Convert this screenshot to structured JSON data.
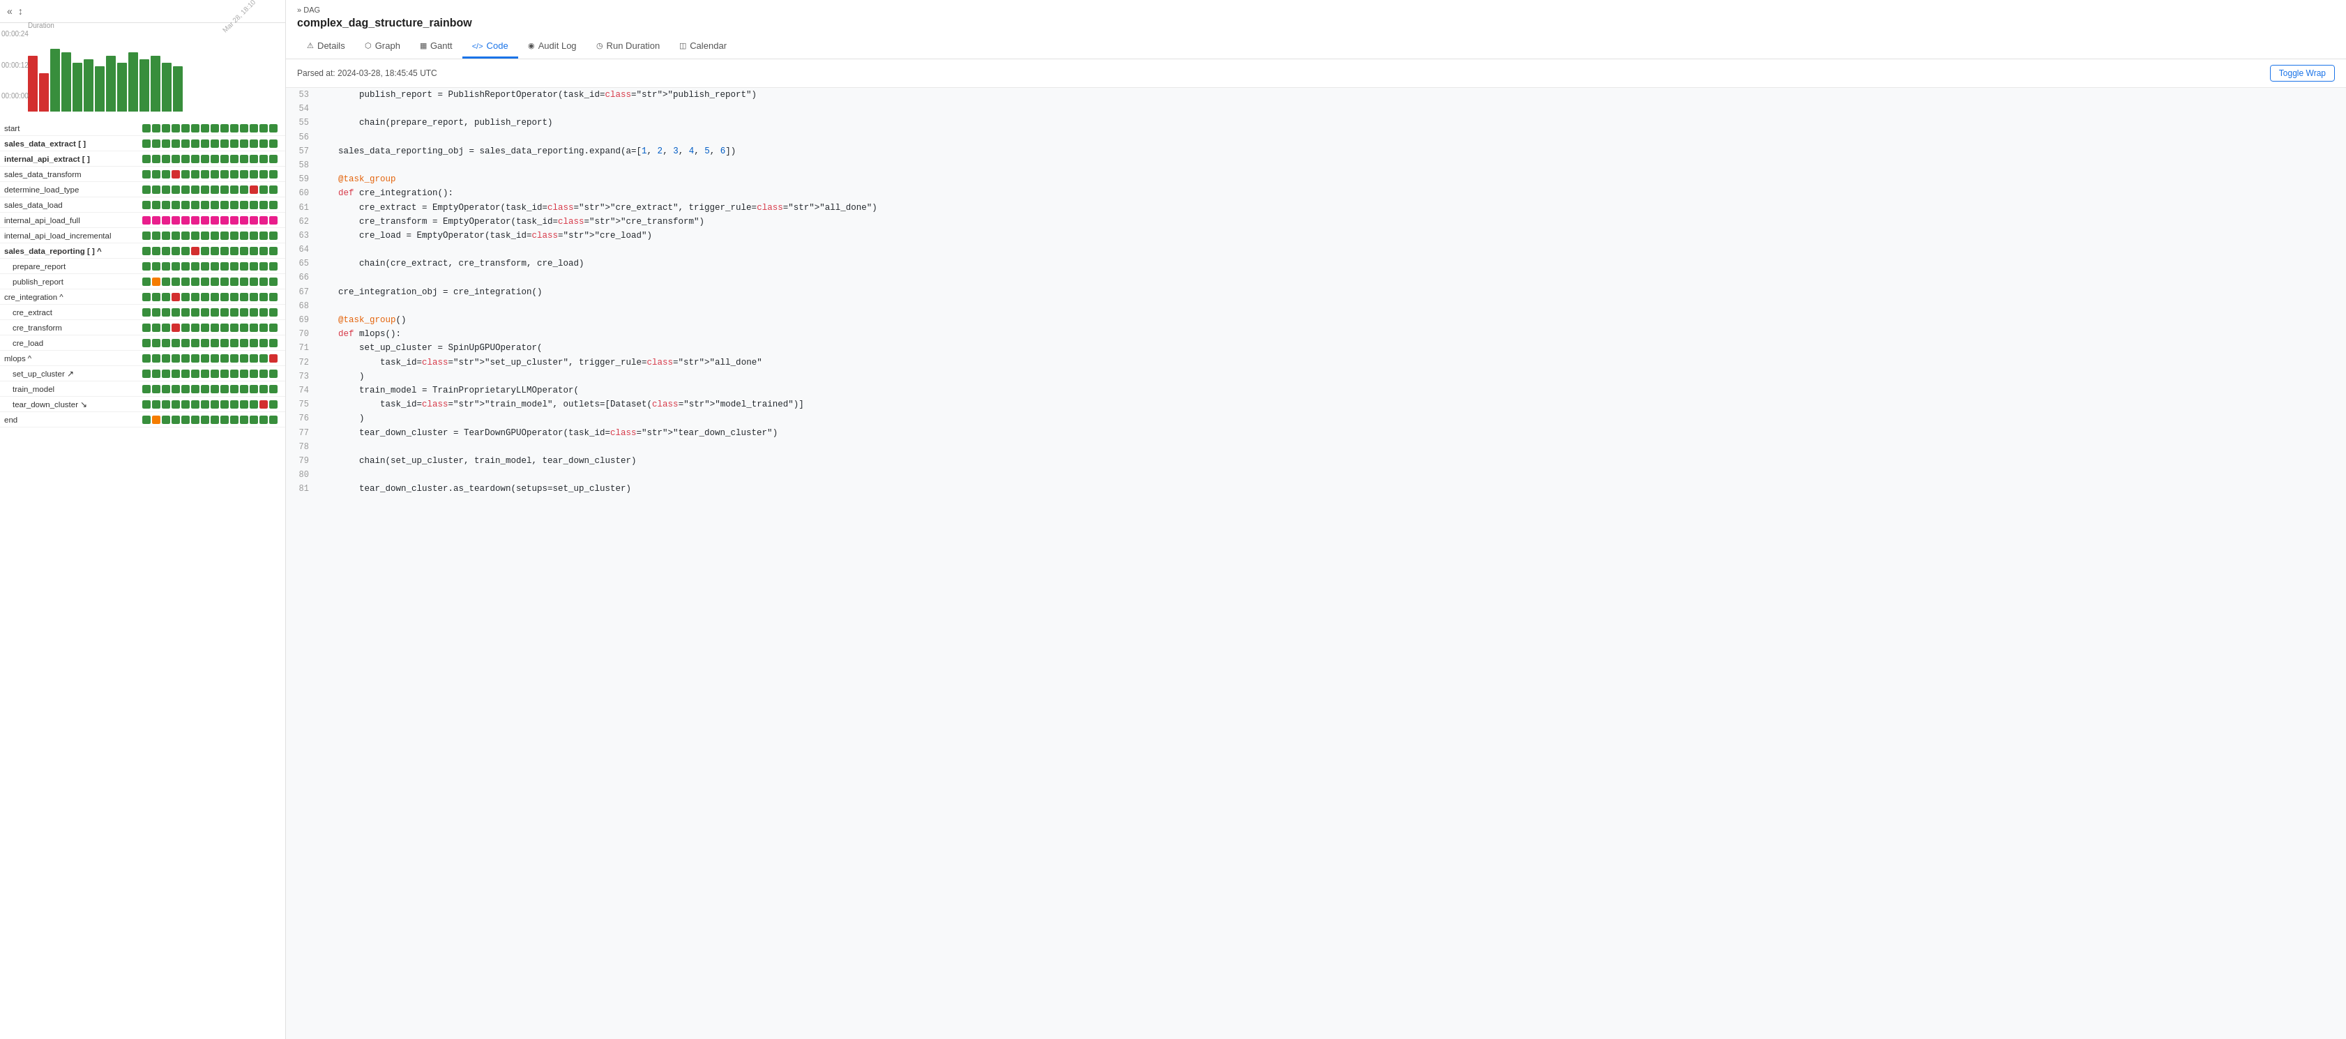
{
  "left": {
    "collapse_icon": "«",
    "duration_label": "Duration",
    "y_labels": [
      "00:00:24",
      "00:00:12",
      "00:00:00"
    ],
    "date_label": "Mar 28, 18:10",
    "bars": [
      {
        "height": 80,
        "color": "#d32f2f"
      },
      {
        "height": 55,
        "color": "#d32f2f"
      },
      {
        "height": 90,
        "color": "#388e3c"
      },
      {
        "height": 85,
        "color": "#388e3c"
      },
      {
        "height": 70,
        "color": "#388e3c"
      },
      {
        "height": 75,
        "color": "#388e3c"
      },
      {
        "height": 65,
        "color": "#388e3c"
      },
      {
        "height": 80,
        "color": "#388e3c"
      },
      {
        "height": 70,
        "color": "#388e3c"
      },
      {
        "height": 85,
        "color": "#388e3c"
      },
      {
        "height": 75,
        "color": "#388e3c"
      },
      {
        "height": 80,
        "color": "#388e3c"
      },
      {
        "height": 70,
        "color": "#388e3c"
      },
      {
        "height": 65,
        "color": "#388e3c"
      }
    ],
    "tasks": [
      {
        "label": "start",
        "bold": false,
        "indent": 0,
        "dots": [
          "g",
          "g",
          "g",
          "g",
          "g",
          "g",
          "g",
          "g",
          "g",
          "g",
          "g",
          "g",
          "g",
          "g"
        ]
      },
      {
        "label": "sales_data_extract [ ]",
        "bold": true,
        "indent": 0,
        "dots": [
          "g",
          "g",
          "g",
          "g",
          "g",
          "g",
          "g",
          "g",
          "g",
          "g",
          "g",
          "g",
          "g",
          "g"
        ]
      },
      {
        "label": "internal_api_extract [ ]",
        "bold": true,
        "indent": 0,
        "dots": [
          "g",
          "g",
          "g",
          "g",
          "g",
          "g",
          "g",
          "g",
          "g",
          "g",
          "g",
          "g",
          "g",
          "g"
        ]
      },
      {
        "label": "sales_data_transform",
        "bold": false,
        "indent": 0,
        "dots": [
          "g",
          "g",
          "g",
          "r",
          "g",
          "g",
          "g",
          "g",
          "g",
          "g",
          "g",
          "g",
          "g",
          "g"
        ]
      },
      {
        "label": "determine_load_type",
        "bold": false,
        "indent": 0,
        "dots": [
          "g",
          "g",
          "g",
          "g",
          "g",
          "g",
          "g",
          "g",
          "g",
          "g",
          "g",
          "r",
          "g",
          "g"
        ]
      },
      {
        "label": "sales_data_load",
        "bold": false,
        "indent": 0,
        "dots": [
          "g",
          "g",
          "g",
          "g",
          "g",
          "g",
          "g",
          "g",
          "g",
          "g",
          "g",
          "g",
          "g",
          "g"
        ]
      },
      {
        "label": "internal_api_load_full",
        "bold": false,
        "indent": 0,
        "dots": [
          "p",
          "p",
          "p",
          "p",
          "p",
          "p",
          "p",
          "p",
          "p",
          "p",
          "p",
          "p",
          "p",
          "p"
        ]
      },
      {
        "label": "internal_api_load_incremental",
        "bold": false,
        "indent": 0,
        "dots": [
          "g",
          "g",
          "g",
          "g",
          "g",
          "g",
          "g",
          "g",
          "g",
          "g",
          "g",
          "g",
          "g",
          "g"
        ]
      },
      {
        "label": "sales_data_reporting [ ] ^",
        "bold": true,
        "indent": 0,
        "dots": [
          "g",
          "g",
          "g",
          "g",
          "g",
          "r",
          "g",
          "g",
          "g",
          "g",
          "g",
          "g",
          "g",
          "g"
        ]
      },
      {
        "label": "prepare_report",
        "bold": false,
        "indent": 1,
        "dots": [
          "g",
          "g",
          "g",
          "g",
          "g",
          "g",
          "g",
          "g",
          "g",
          "g",
          "g",
          "g",
          "g",
          "g"
        ]
      },
      {
        "label": "publish_report",
        "bold": false,
        "indent": 1,
        "dots": [
          "g",
          "o",
          "g",
          "g",
          "g",
          "g",
          "g",
          "g",
          "g",
          "g",
          "g",
          "g",
          "g",
          "g"
        ]
      },
      {
        "label": "cre_integration ^",
        "bold": false,
        "indent": 0,
        "dots": [
          "g",
          "g",
          "g",
          "r",
          "g",
          "g",
          "g",
          "g",
          "g",
          "g",
          "g",
          "g",
          "g",
          "g"
        ]
      },
      {
        "label": "cre_extract",
        "bold": false,
        "indent": 1,
        "dots": [
          "g",
          "g",
          "g",
          "g",
          "g",
          "g",
          "g",
          "g",
          "g",
          "g",
          "g",
          "g",
          "g",
          "g"
        ]
      },
      {
        "label": "cre_transform",
        "bold": false,
        "indent": 1,
        "dots": [
          "g",
          "g",
          "g",
          "r",
          "g",
          "g",
          "g",
          "g",
          "g",
          "g",
          "g",
          "g",
          "g",
          "g"
        ]
      },
      {
        "label": "cre_load",
        "bold": false,
        "indent": 1,
        "dots": [
          "g",
          "g",
          "g",
          "g",
          "g",
          "g",
          "g",
          "g",
          "g",
          "g",
          "g",
          "g",
          "g",
          "g"
        ]
      },
      {
        "label": "mlops ^",
        "bold": false,
        "indent": 0,
        "dots": [
          "g",
          "g",
          "g",
          "g",
          "g",
          "g",
          "g",
          "g",
          "g",
          "g",
          "g",
          "g",
          "g",
          "r"
        ]
      },
      {
        "label": "set_up_cluster ↗",
        "bold": false,
        "indent": 1,
        "dots": [
          "g",
          "g",
          "g",
          "g",
          "g",
          "g",
          "g",
          "g",
          "g",
          "g",
          "g",
          "g",
          "g",
          "g"
        ]
      },
      {
        "label": "train_model",
        "bold": false,
        "indent": 1,
        "dots": [
          "g",
          "g",
          "g",
          "g",
          "g",
          "g",
          "g",
          "g",
          "g",
          "g",
          "g",
          "g",
          "g",
          "g"
        ]
      },
      {
        "label": "tear_down_cluster ↘",
        "bold": false,
        "indent": 1,
        "dots": [
          "g",
          "g",
          "g",
          "g",
          "g",
          "g",
          "g",
          "g",
          "g",
          "g",
          "g",
          "g",
          "r",
          "g"
        ]
      },
      {
        "label": "end",
        "bold": false,
        "indent": 0,
        "dots": [
          "g",
          "o",
          "g",
          "g",
          "g",
          "g",
          "g",
          "g",
          "g",
          "g",
          "g",
          "g",
          "g",
          "g"
        ]
      }
    ],
    "dot_colors": {
      "g": "#388e3c",
      "r": "#d32f2f",
      "p": "#e91e8c",
      "o": "#f57c00"
    }
  },
  "right": {
    "breadcrumb": "DAG",
    "dag_title": "complex_dag_structure_rainbow",
    "tabs": [
      {
        "label": "Details",
        "icon": "⚠",
        "active": false
      },
      {
        "label": "Graph",
        "icon": "⬡",
        "active": false
      },
      {
        "label": "Gantt",
        "icon": "▦",
        "active": false
      },
      {
        "label": "Code",
        "icon": "</>",
        "active": true
      },
      {
        "label": "Audit Log",
        "icon": "✕",
        "active": false
      },
      {
        "label": "Run Duration",
        "icon": "✕",
        "active": false
      },
      {
        "label": "Calendar",
        "icon": "▦",
        "active": false
      }
    ],
    "parsed_at": "Parsed at: 2024-03-28, 18:45:45 UTC",
    "toggle_wrap_label": "Toggle Wrap",
    "code_lines": [
      {
        "num": 53,
        "content": "        publish_report = PublishReportOperator(task_id=\"publish_report\")"
      },
      {
        "num": 54,
        "content": ""
      },
      {
        "num": 55,
        "content": "        chain(prepare_report, publish_report)"
      },
      {
        "num": 56,
        "content": ""
      },
      {
        "num": 57,
        "content": "    sales_data_reporting_obj = sales_data_reporting.expand(a=[1, 2, 3, 4, 5, 6])"
      },
      {
        "num": 58,
        "content": ""
      },
      {
        "num": 59,
        "content": "    @task_group"
      },
      {
        "num": 60,
        "content": "    def cre_integration():"
      },
      {
        "num": 61,
        "content": "        cre_extract = EmptyOperator(task_id=\"cre_extract\", trigger_rule=\"all_done\")"
      },
      {
        "num": 62,
        "content": "        cre_transform = EmptyOperator(task_id=\"cre_transform\")"
      },
      {
        "num": 63,
        "content": "        cre_load = EmptyOperator(task_id=\"cre_load\")"
      },
      {
        "num": 64,
        "content": ""
      },
      {
        "num": 65,
        "content": "        chain(cre_extract, cre_transform, cre_load)"
      },
      {
        "num": 66,
        "content": ""
      },
      {
        "num": 67,
        "content": "    cre_integration_obj = cre_integration()"
      },
      {
        "num": 68,
        "content": ""
      },
      {
        "num": 69,
        "content": "    @task_group()"
      },
      {
        "num": 70,
        "content": "    def mlops():"
      },
      {
        "num": 71,
        "content": "        set_up_cluster = SpinUpGPUOperator("
      },
      {
        "num": 72,
        "content": "            task_id=\"set_up_cluster\", trigger_rule=\"all_done\""
      },
      {
        "num": 73,
        "content": "        )"
      },
      {
        "num": 74,
        "content": "        train_model = TrainProprietaryLLMOperator("
      },
      {
        "num": 75,
        "content": "            task_id=\"train_model\", outlets=[Dataset(\"model_trained\")]"
      },
      {
        "num": 76,
        "content": "        )"
      },
      {
        "num": 77,
        "content": "        tear_down_cluster = TearDownGPUOperator(task_id=\"tear_down_cluster\")"
      },
      {
        "num": 78,
        "content": ""
      },
      {
        "num": 79,
        "content": "        chain(set_up_cluster, train_model, tear_down_cluster)"
      },
      {
        "num": 80,
        "content": ""
      },
      {
        "num": 81,
        "content": "        tear_down_cluster.as_teardown(setups=set_up_cluster)"
      }
    ]
  }
}
